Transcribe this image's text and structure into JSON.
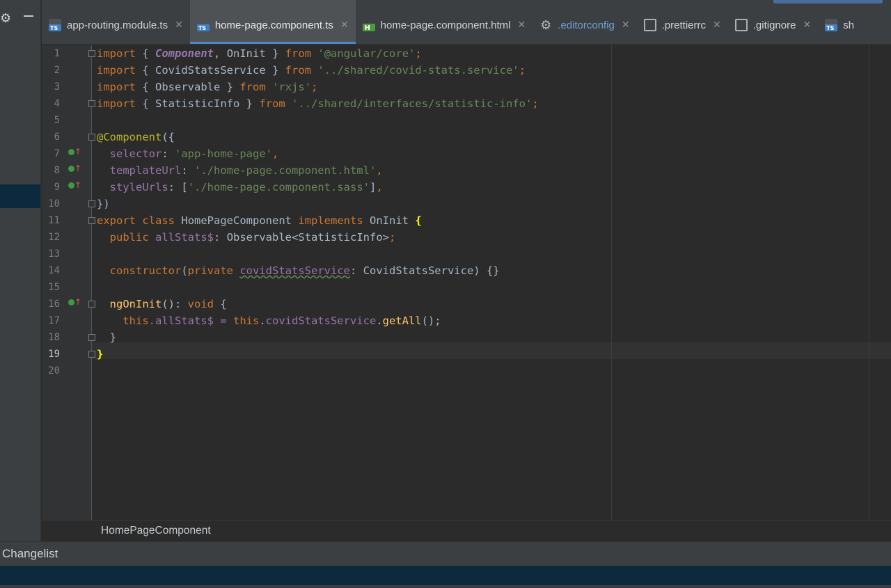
{
  "left_panel": {
    "settings_icon": "gear-icon",
    "collapse_icon": "minus-icon"
  },
  "tabs": [
    {
      "label": "app-routing.module.ts",
      "icon": "typescript-file-icon",
      "active": false
    },
    {
      "label": "home-page.component.ts",
      "icon": "typescript-file-icon",
      "active": true
    },
    {
      "label": "home-page.component.html",
      "icon": "html-file-icon",
      "active": false
    },
    {
      "label": ".editorconfig",
      "icon": "gear-icon",
      "active": false
    },
    {
      "label": ".prettierrc",
      "icon": "config-file-icon",
      "active": false
    },
    {
      "label": ".gitignore",
      "icon": "ignore-file-icon",
      "active": false
    },
    {
      "label": "sh",
      "icon": "typescript-file-icon",
      "active": false
    }
  ],
  "editor": {
    "line_numbers": [
      "1",
      "2",
      "3",
      "4",
      "5",
      "6",
      "7",
      "8",
      "9",
      "10",
      "11",
      "12",
      "13",
      "14",
      "15",
      "16",
      "17",
      "18",
      "19",
      "20"
    ],
    "current_line": "19",
    "tokens": {
      "import": "import",
      "from": "from",
      "open_brace": "{ ",
      "close_brace": " }",
      "semi": ";",
      "comma": ", ",
      "Component": "Component",
      "OnInit": "OnInit",
      "angular_core": "'@angular/core'",
      "CovidStatsService": "CovidStatsService",
      "covid_path": "'../shared/covid-stats.service'",
      "Observable": "Observable",
      "rxjs": "'rxjs'",
      "StatisticInfo": "StatisticInfo",
      "interfaces_path": "'../shared/interfaces/statistic-info'",
      "decorator": "@Component",
      "paren_brace": "({",
      "selector": "selector",
      "selector_val": "'app-home-page'",
      "templateUrl": "templateUrl",
      "template_val": "'./home-page.component.html'",
      "styleUrls": "styleUrls",
      "style_val": "'./home-page.component.sass'",
      "colon": ": ",
      "trailing_comma": ",",
      "close_decorator": "})",
      "export": "export",
      "class": "class",
      "HomePageComponent": "HomePageComponent",
      "implements": "implements",
      "brace": "{",
      "public": "public",
      "allStats": "allStats$",
      "generic": "Observable<StatisticInfo>",
      "constructor": "constructor",
      "private": "private",
      "covidStatsService": "covidStatsService",
      "ctor_tail": ") {}",
      "ngOnInit": "ngOnInit",
      "parens_colon": "(): ",
      "void": "void",
      "this": "this",
      "allStats_assign": ".allStats$ = ",
      "dot": ".",
      "getAll": "getAll",
      "call_end": "();",
      "close": "}"
    }
  },
  "breadcrumb": "HomePageComponent",
  "changelist": "Changelist",
  "colors": {
    "keyword": "#cc7832",
    "string": "#6a8759",
    "field": "#9876aa",
    "function": "#ffc66d",
    "annotation": "#bbb529",
    "accent": "#4a88c7"
  }
}
